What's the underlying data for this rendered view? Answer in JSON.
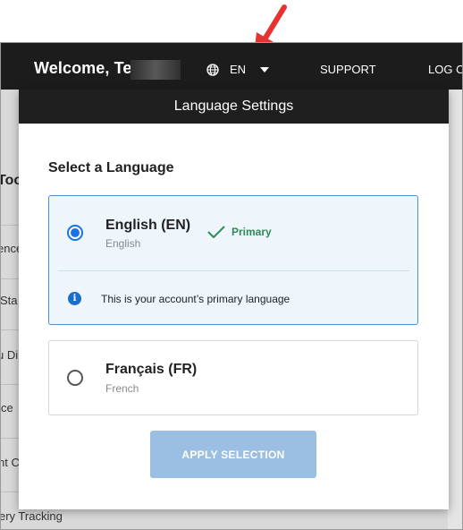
{
  "header": {
    "welcome_text": "Welcome, Te",
    "language_code": "EN",
    "support_label": "SUPPORT",
    "logout_label": "LOG OUT"
  },
  "background_page": {
    "items": [
      "Too",
      "ence",
      "Sta",
      "u Di",
      "ce",
      "nt C",
      "ery Tracking"
    ]
  },
  "modal": {
    "title": "Language Settings",
    "subtitle": "Select a Language",
    "options": [
      {
        "name": "English (EN)",
        "native": "English",
        "selected": true,
        "badge": "Primary",
        "info": "This is your account’s primary language"
      },
      {
        "name": "Français (FR)",
        "native": "French",
        "selected": false
      }
    ],
    "apply_label": "APPLY SELECTION"
  },
  "colors": {
    "header_bg": "#1c1c1c",
    "selected_border": "#4a90d9",
    "selected_bg": "#eef6fc",
    "radio_accent": "#1a73e8",
    "primary_green": "#2e8b57",
    "apply_button_bg": "#9abfe3",
    "annotation_arrow": "#e8322f"
  }
}
